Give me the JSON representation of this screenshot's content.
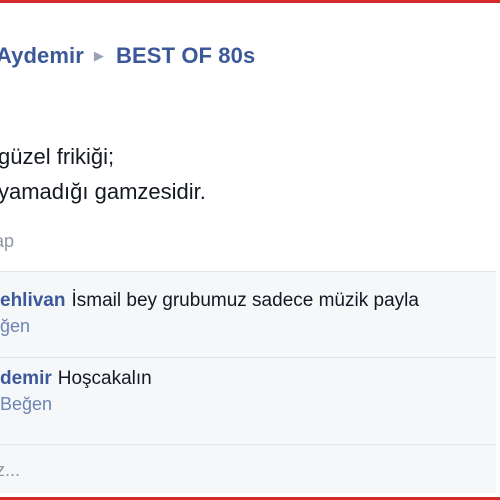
{
  "post": {
    "author": "Aydemir",
    "group": "BEST OF 80s",
    "sub": "l",
    "lines": [
      "güzel frikiği;",
      "yamadığı gamzesidir."
    ],
    "action": "ap"
  },
  "comments": [
    {
      "name": "ehlivan",
      "text": "İsmail bey grubumuz sadece müzik payla",
      "like": "ğen"
    },
    {
      "name": "demir",
      "text": "Hoşcakalın",
      "like": "Beğen"
    }
  ],
  "write_comment": {
    "placeholder": "z..."
  },
  "colors": {
    "frame_border": "#d42a2a",
    "link_blue": "#3b5998",
    "muted_gray": "#9197a3",
    "comment_bg": "#f6f7f8"
  }
}
